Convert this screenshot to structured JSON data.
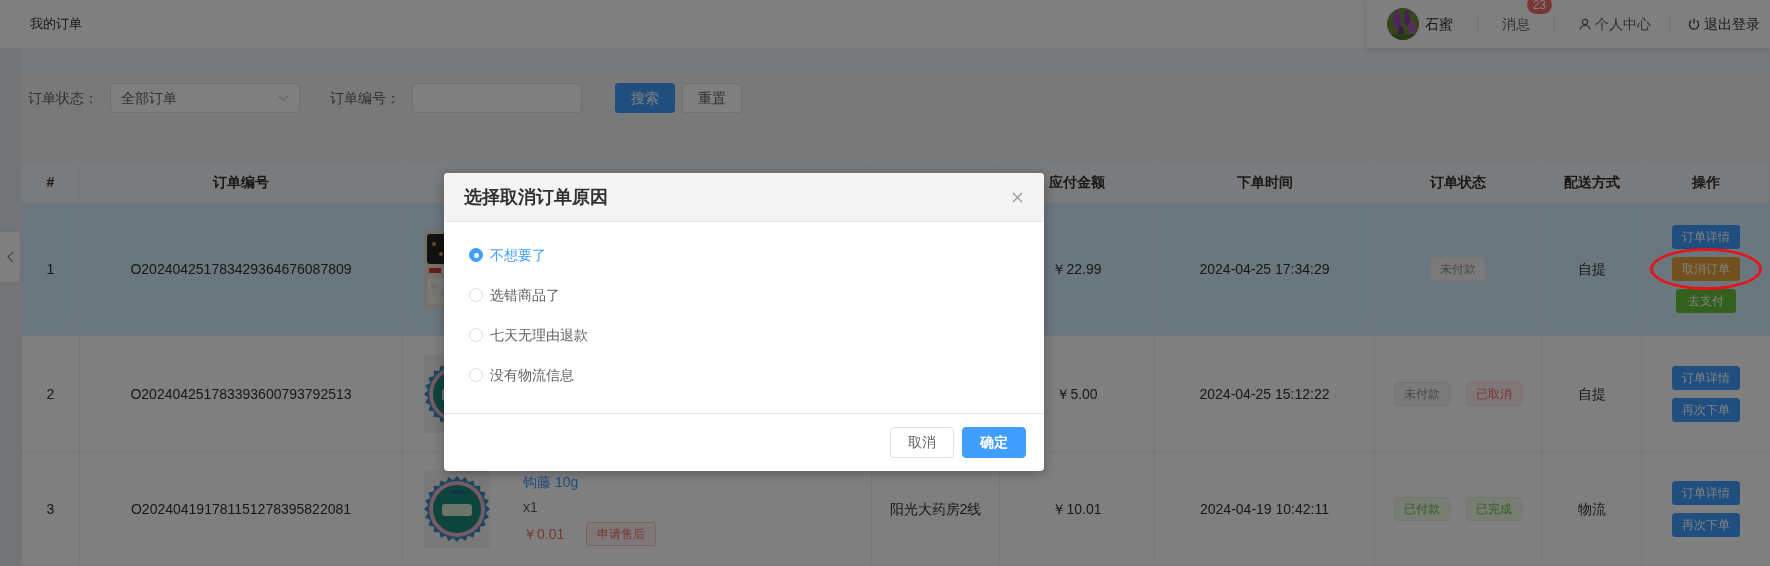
{
  "header": {
    "title": "我的订单",
    "user_name": "石蜜",
    "messages": {
      "label": "消息",
      "badge": "23"
    },
    "profile": "个人中心",
    "logout": "退出登录"
  },
  "filters": {
    "status_label": "订单状态：",
    "status_value": "全部订单",
    "number_label": "订单编号：",
    "buttons": [
      {
        "label": "搜索",
        "kind": "primary"
      },
      {
        "label": "重置",
        "kind": "default"
      }
    ]
  },
  "table": {
    "columns": [
      "#",
      "订单编号",
      "应付金额",
      "下单时间",
      "订单状态",
      "配送方式",
      "操作"
    ],
    "rows": [
      {
        "index": "1",
        "number": "O202404251783429364676087809",
        "selected": true,
        "product": {
          "kind": "picture"
        },
        "amount": "￥22.99",
        "time": "2024-04-25 17:34:29",
        "statuses": [
          {
            "label": "未付款",
            "kind": "neutral"
          }
        ],
        "delivery": "自提",
        "actions": [
          {
            "label": "订单详情",
            "kind": "primary",
            "highlighted": false
          },
          {
            "label": "取消订单",
            "kind": "warning",
            "highlighted": true
          },
          {
            "label": "去支付",
            "kind": "success",
            "highlighted": false
          }
        ]
      },
      {
        "index": "2",
        "number": "O202404251783393600793792513",
        "selected": false,
        "product": {
          "kind": "picture"
        },
        "amount": "￥5.00",
        "time": "2024-04-25 15:12:22",
        "statuses": [
          {
            "label": "未付款",
            "kind": "neutral"
          },
          {
            "label": "已取消",
            "kind": "danger"
          }
        ],
        "delivery": "自提",
        "actions": [
          {
            "label": "订单详情",
            "kind": "primary",
            "highlighted": false
          },
          {
            "label": "再次下单",
            "kind": "primary",
            "highlighted": false
          }
        ]
      },
      {
        "index": "3",
        "number": "O202404191781151278395822081",
        "selected": false,
        "product": {
          "kind": "picture",
          "name": "钩藤 10g",
          "quantity": "x1",
          "price": "￥0.01",
          "after_sale": "申请售后"
        },
        "store": "阳光大药房2线",
        "amount": "￥10.01",
        "time": "2024-04-19 10:42:11",
        "statuses": [
          {
            "label": "已付款",
            "kind": "success"
          },
          {
            "label": "已完成",
            "kind": "success"
          }
        ],
        "delivery": "物流",
        "actions": [
          {
            "label": "订单详情",
            "kind": "primary",
            "highlighted": false
          },
          {
            "label": "再次下单",
            "kind": "primary",
            "highlighted": false
          }
        ]
      }
    ]
  },
  "dialog": {
    "title": "选择取消订单原因",
    "options": [
      {
        "label": "不想要了",
        "selected": true
      },
      {
        "label": "选错商品了",
        "selected": false
      },
      {
        "label": "七天无理由退款",
        "selected": false
      },
      {
        "label": "没有物流信息",
        "selected": false
      }
    ],
    "buttons": [
      {
        "label": "取消",
        "kind": "default"
      },
      {
        "label": "确定",
        "kind": "primary"
      }
    ]
  }
}
